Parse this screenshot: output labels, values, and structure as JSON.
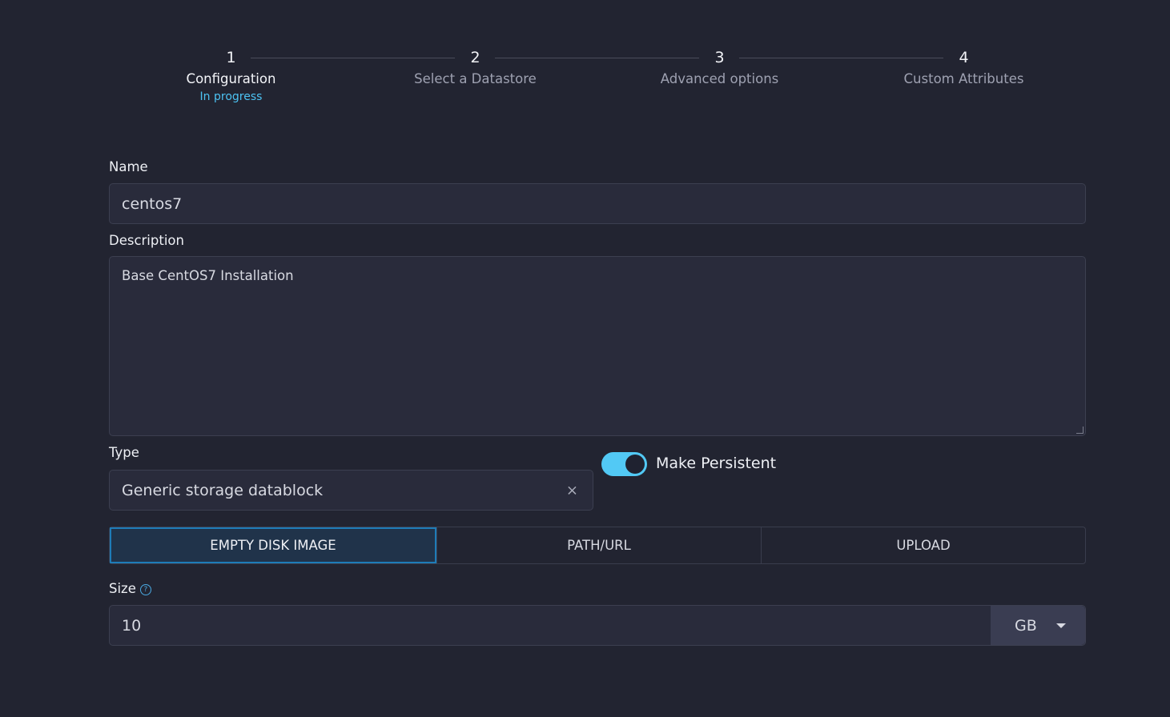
{
  "stepper": {
    "steps": [
      {
        "number": "1",
        "label": "Configuration",
        "status": "In progress"
      },
      {
        "number": "2",
        "label": "Select a Datastore"
      },
      {
        "number": "3",
        "label": "Advanced options"
      },
      {
        "number": "4",
        "label": "Custom Attributes"
      }
    ]
  },
  "form": {
    "name_label": "Name",
    "name_value": "centos7",
    "description_label": "Description",
    "description_value": "Base CentOS7 Installation",
    "type_label": "Type",
    "type_value": "Generic storage datablock",
    "type_clear_icon": "×",
    "persistent_label": "Make Persistent",
    "persistent_on": true,
    "source_tabs": [
      "EMPTY DISK IMAGE",
      "PATH/URL",
      "UPLOAD"
    ],
    "source_selected": "EMPTY DISK IMAGE",
    "size_label": "Size",
    "size_help_icon": "?",
    "size_value": "10",
    "size_unit": "GB"
  },
  "colors": {
    "background": "#222431",
    "accent": "#52c9f5",
    "status": "#4cc2f2",
    "tab_active_border": "#1e7cb8"
  }
}
